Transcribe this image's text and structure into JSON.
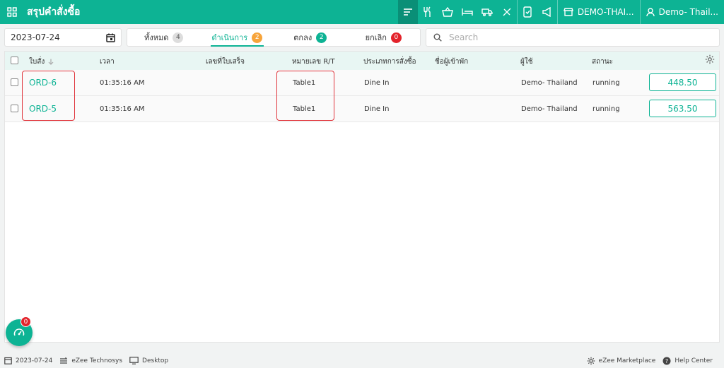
{
  "header": {
    "title": "สรุปคำสั่งซื้อ",
    "store_label": "DEMO-THAI...",
    "user_label": "Demo- Thail..."
  },
  "filters": {
    "date": "2023-07-24",
    "search_placeholder": "Search",
    "tabs": [
      {
        "label": "ทั้งหมด",
        "count": "4"
      },
      {
        "label": "ดำเนินการ",
        "count": "2"
      },
      {
        "label": "ตกลง",
        "count": "2"
      },
      {
        "label": "ยกเลิก",
        "count": "0"
      }
    ]
  },
  "table": {
    "columns": [
      "ใบสั่ง",
      "เวลา",
      "เลขที่ใบเสร็จ",
      "หมายเลข R/T",
      "ประเภทการสั่งซื้อ",
      "ชื่อผู้เข้าพัก",
      "ผู้ใช้",
      "สถานะ"
    ],
    "rows": [
      {
        "order": "ORD-6",
        "time": "01:35:16 AM",
        "receipt": "",
        "rt": "Table1",
        "type": "Dine In",
        "guest": "",
        "user": "Demo- Thailand",
        "status": "running",
        "amount": "448.50"
      },
      {
        "order": "ORD-5",
        "time": "01:35:16 AM",
        "receipt": "",
        "rt": "Table1",
        "type": "Dine In",
        "guest": "",
        "user": "Demo- Thailand",
        "status": "running",
        "amount": "563.50"
      }
    ]
  },
  "fab": {
    "badge": "0"
  },
  "footer": {
    "date": "2023-07-24",
    "company": "eZee Technosys",
    "device": "Desktop",
    "marketplace": "eZee Marketplace",
    "help": "Help Center"
  },
  "colors": {
    "accent": "#0db394",
    "highlight": "#e0343b"
  }
}
